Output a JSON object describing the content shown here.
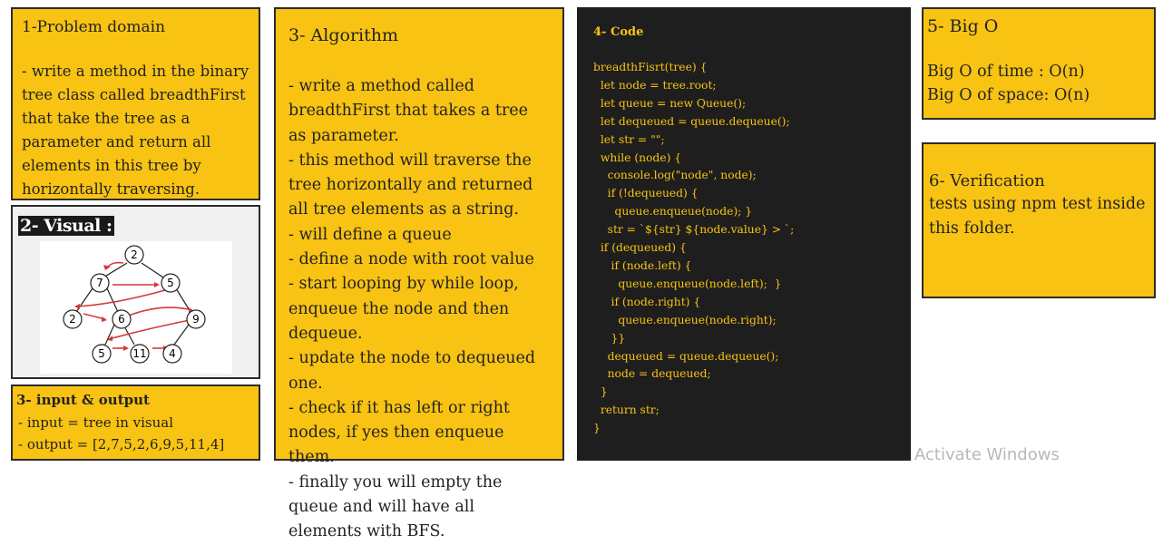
{
  "problem": {
    "title": "1-Problem domain",
    "body": "- write a method in the binary tree class called breadthFirst that take the tree as a parameter and return all elements in this tree by horizontally traversing."
  },
  "visual": {
    "title": "2- Visual :",
    "nodes": [
      "2",
      "7",
      "5",
      "2",
      "6",
      "9",
      "5",
      "11",
      "4"
    ]
  },
  "io": {
    "title": "3- input & output",
    "input": "- input = tree in visual",
    "output": "- output = [2,7,5,2,6,9,5,11,4]"
  },
  "algorithm": {
    "title": "3- Algorithm",
    "body": "- write a method called breadthFirst that takes a tree as parameter.\n- this method will traverse the tree horizontally and returned all tree elements as a string.\n- will define a queue\n- define a node with root value\n- start looping by while loop, enqueue the node and then dequeue.\n- update the node to dequeued one.\n- check if it has left or right nodes, if yes then enqueue them.\n- finally you will empty the queue and will have all elements with BFS."
  },
  "code": {
    "title": "4- Code",
    "source": "breadthFisrt(tree) {\n  let node = tree.root;\n  let queue = new Queue();\n  let dequeued = queue.dequeue();\n  let str = \"\";\n  while (node) {\n    console.log(\"node\", node);\n    if (!dequeued) {\n      queue.enqueue(node); }\n    str = `${str} ${node.value} > `;\n  if (dequeued) {\n     if (node.left) {\n       queue.enqueue(node.left);  }\n     if (node.right) {\n       queue.enqueue(node.right);\n     }}\n    dequeued = queue.dequeue();\n    node = dequeued;\n  }\n  return str;\n}"
  },
  "bigo": {
    "title": "5- Big O",
    "time": "Big O of time : O(n)",
    "space": "Big O of space: O(n)"
  },
  "verification": {
    "title": "6- Verification",
    "body": "tests using npm test inside this folder."
  },
  "watermark": "Activate Windows"
}
